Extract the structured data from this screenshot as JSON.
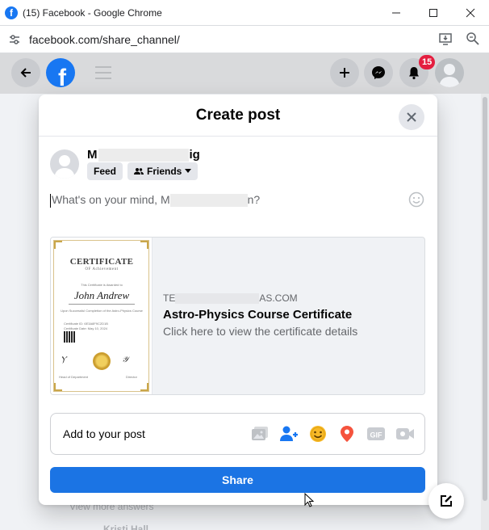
{
  "window": {
    "title": "(15) Facebook - Google Chrome",
    "favicon_letter": "f",
    "minimize_icon": "minimize-icon",
    "maximize_icon": "maximize-icon",
    "close_icon": "close-icon"
  },
  "address_bar": {
    "url": "facebook.com/share_channel/"
  },
  "fb_nav": {
    "logo_letter": "f",
    "notifications_count": "15"
  },
  "background": {
    "view_more": "View more answers",
    "commenter": "Kristi Hall"
  },
  "modal": {
    "title": "Create post",
    "user": {
      "name_start": "M",
      "name_end": "ig"
    },
    "audience": {
      "feed_label": "Feed",
      "friends_label": "Friends"
    },
    "composer": {
      "placeholder_start": "What's on your mind, M",
      "placeholder_end": "n?"
    },
    "link_preview": {
      "domain_start": "TE",
      "domain_end": "AS.COM",
      "title": "Astro-Physics Course Certificate",
      "description": "Click here to view the certificate details",
      "certificate": {
        "heading": "CERTIFICATE",
        "subheading": "OF Achievement",
        "awarded_line": "This Certificate is Awarded to",
        "recipient": "John Andrew",
        "completion_line": "Upon Successful Completion of the Astro-Physics Course",
        "cert_id": "Certificate ID: 6E3A8F9C2D1B",
        "cert_date": "Certificate Date: May 10, 2024",
        "sig_left": "Head of Department",
        "sig_right": "Director"
      }
    },
    "add_to_post": {
      "label": "Add to your post",
      "icons": [
        "photo-video-icon",
        "tag-people-icon",
        "feeling-icon",
        "check-in-icon",
        "gif-icon",
        "live-video-icon"
      ],
      "gif_text": "GIF"
    },
    "share_label": "Share"
  },
  "colors": {
    "fb_blue": "#1877f2",
    "share_blue": "#1b74e4",
    "badge_red": "#e41e3f",
    "tag_people": "#1877f2",
    "feeling_yellow": "#f7b928",
    "checkin_red": "#f5533d"
  }
}
